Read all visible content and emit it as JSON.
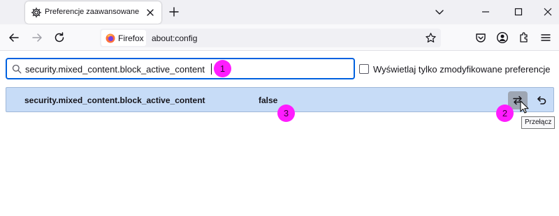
{
  "tab": {
    "title": "Preferencje zaawansowane",
    "icon": "gear-icon"
  },
  "navbar": {
    "identity_label": "Firefox",
    "url": "about:config"
  },
  "config": {
    "search_value": "security.mixed_content.block_active_content",
    "modified_only_label": "Wyświetlaj tylko zmodyfikowane preferencje",
    "modified_only_checked": false,
    "pref": {
      "name": "security.mixed_content.block_active_content",
      "value": "false"
    },
    "toggle_tooltip": "Przełącz"
  },
  "markers": [
    "1",
    "2",
    "3"
  ],
  "colors": {
    "accent": "#0061e0",
    "row_highlight": "#c7dcf7",
    "marker": "#ff1cff"
  }
}
